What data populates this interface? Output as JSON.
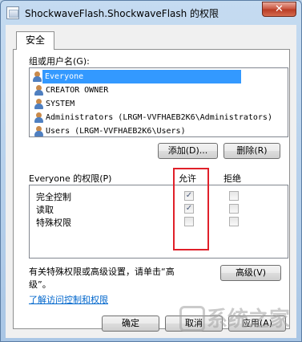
{
  "window": {
    "title": "ShockwaveFlash.ShockwaveFlash 的权限",
    "close_glyph": "✕"
  },
  "tab": {
    "label": "安全"
  },
  "users_section": {
    "label": "组或用户名(G):",
    "items": [
      {
        "name": "Everyone",
        "selected": true
      },
      {
        "name": "CREATOR OWNER",
        "selected": false
      },
      {
        "name": "SYSTEM",
        "selected": false
      },
      {
        "name": "Administrators (LRGM-VVFHAEB2K6\\Administrators)",
        "selected": false
      },
      {
        "name": "Users (LRGM-VVFHAEB2K6\\Users)",
        "selected": false
      }
    ],
    "add_label": "添加(D)...",
    "remove_label": "删除(R)"
  },
  "permissions": {
    "label": "Everyone 的权限(P)",
    "allow_header": "允许",
    "deny_header": "拒绝",
    "rows": [
      {
        "name": "完全控制",
        "allow": true,
        "deny": false
      },
      {
        "name": "读取",
        "allow": true,
        "deny": false
      },
      {
        "name": "特殊权限",
        "allow": false,
        "deny": false
      }
    ]
  },
  "advanced": {
    "hint_line1": "有关特殊权限或高级设置，请单击“高",
    "hint_line2": "级”。",
    "button_label": "高级(V)"
  },
  "learn_link": "了解访问控制和权限",
  "footer": {
    "ok_label": "确定",
    "cancel_label": "取消",
    "apply_label": "应用(A)"
  },
  "watermark_text": "系统之家",
  "colors": {
    "selection": "#3399ff",
    "highlight_box": "#e0202a",
    "link": "#0066cc"
  }
}
